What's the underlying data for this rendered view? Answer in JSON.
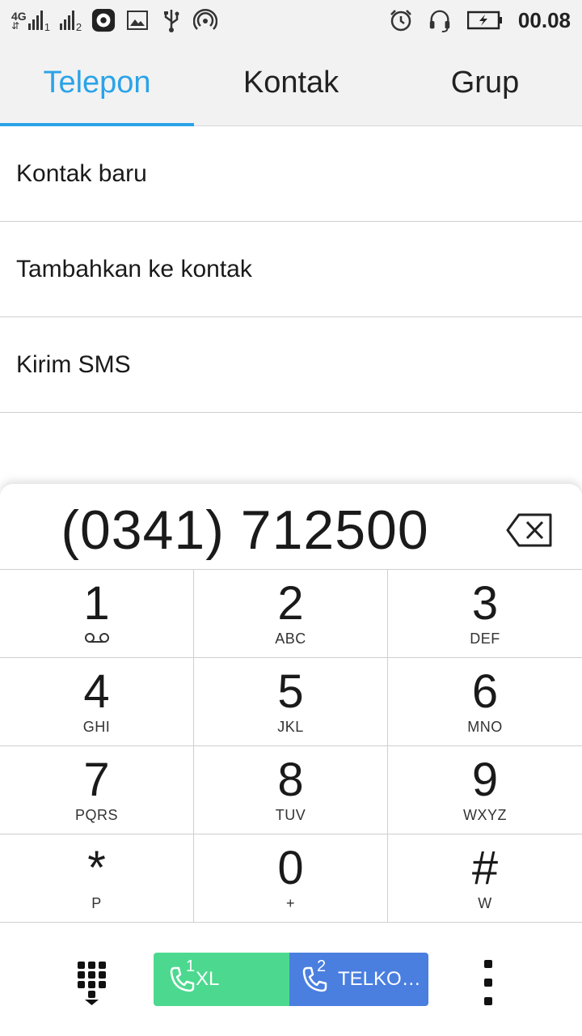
{
  "status_bar": {
    "network": "4G",
    "sim1_label": "1",
    "sim2_label": "2",
    "time": "00.08",
    "icons": [
      "signal-icon",
      "music-icon",
      "image-icon",
      "usb-icon",
      "hotspot-icon",
      "alarm-icon",
      "headset-icon",
      "battery-charging-icon"
    ]
  },
  "tabs": [
    {
      "label": "Telepon",
      "active": true
    },
    {
      "label": "Kontak",
      "active": false
    },
    {
      "label": "Grup",
      "active": false
    }
  ],
  "options": [
    {
      "label": "Kontak baru"
    },
    {
      "label": "Tambahkan ke kontak"
    },
    {
      "label": "Kirim SMS"
    }
  ],
  "dialer": {
    "number": "(0341) 712500",
    "keys": [
      {
        "digit": "1",
        "letters": "voicemail"
      },
      {
        "digit": "2",
        "letters": "ABC"
      },
      {
        "digit": "3",
        "letters": "DEF"
      },
      {
        "digit": "4",
        "letters": "GHI"
      },
      {
        "digit": "5",
        "letters": "JKL"
      },
      {
        "digit": "6",
        "letters": "MNO"
      },
      {
        "digit": "7",
        "letters": "PQRS"
      },
      {
        "digit": "8",
        "letters": "TUV"
      },
      {
        "digit": "9",
        "letters": "WXYZ"
      },
      {
        "digit": "*",
        "letters": "P"
      },
      {
        "digit": "0",
        "letters": "+"
      },
      {
        "digit": "#",
        "letters": "W"
      }
    ],
    "call_sim1": {
      "slot": "1",
      "label": "XL",
      "color": "#4cd98f"
    },
    "call_sim2": {
      "slot": "2",
      "label": "TELKOM...",
      "color": "#4a7fe0"
    }
  },
  "colors": {
    "accent": "#2aa3e8"
  }
}
